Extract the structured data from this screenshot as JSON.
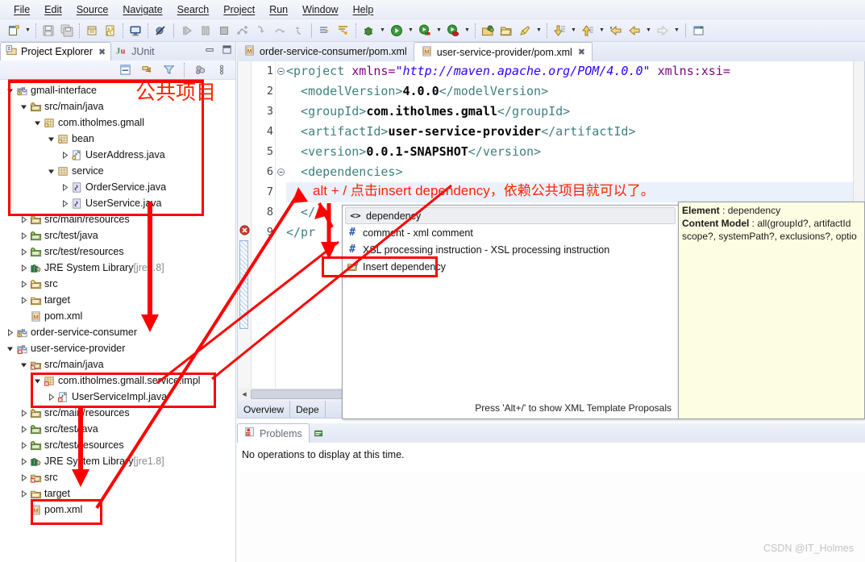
{
  "menubar": {
    "items": [
      {
        "label": "File"
      },
      {
        "label": "Edit"
      },
      {
        "label": "Source"
      },
      {
        "label": "Navigate"
      },
      {
        "label": "Search"
      },
      {
        "label": "Project"
      },
      {
        "label": "Run"
      },
      {
        "label": "Window"
      },
      {
        "label": "Help"
      }
    ]
  },
  "toolbar": {
    "icons": [
      {
        "name": "new-wizard-icon"
      },
      {
        "name": "new-dropdown-arrow-icon"
      },
      {
        "name": "save-icon"
      },
      {
        "name": "save-all-icon"
      },
      {
        "name": "print-icon"
      },
      {
        "name": "build-all-icon"
      },
      {
        "name": "open-console-icon"
      },
      {
        "name": "skip-breakpoints-icon"
      },
      {
        "name": "resume-icon"
      },
      {
        "name": "suspend-icon"
      },
      {
        "name": "terminate-icon"
      },
      {
        "name": "disconnect-icon"
      },
      {
        "name": "step-into-icon"
      },
      {
        "name": "step-over-icon"
      },
      {
        "name": "step-return-icon"
      },
      {
        "name": "next-annotation-icon"
      },
      {
        "name": "previous-annotation-icon"
      },
      {
        "name": "debug-icon"
      },
      {
        "name": "run-icon"
      },
      {
        "name": "run-last-tool-icon"
      },
      {
        "name": "coverage-icon"
      },
      {
        "name": "new-java-package-icon"
      },
      {
        "name": "new-folder-icon"
      },
      {
        "name": "search-icon"
      },
      {
        "name": "next-edit-icon"
      },
      {
        "name": "previous-edit-icon"
      },
      {
        "name": "back-history-icon"
      },
      {
        "name": "forward-history-icon"
      },
      {
        "name": "pin-editor-icon"
      }
    ]
  },
  "left_panel": {
    "tabs": [
      {
        "label": "Project Explorer",
        "icon": "project-explorer-icon",
        "active": true,
        "closeable": true
      },
      {
        "label": "JUnit",
        "icon": "junit-icon",
        "active": false,
        "closeable": false
      }
    ],
    "window_controls": [
      {
        "name": "minimize-icon"
      },
      {
        "name": "maximize-icon"
      }
    ],
    "view_toolbar": [
      {
        "name": "collapse-all-icon"
      },
      {
        "name": "link-with-editor-icon"
      },
      {
        "name": "filter-icon"
      },
      {
        "name": "working-sets-icon"
      },
      {
        "name": "view-menu-icon"
      }
    ],
    "tree": [
      {
        "label": "gmall-interface",
        "indent": 0,
        "icon": "maven-project-icon",
        "twisty": "expanded"
      },
      {
        "label": "src/main/java",
        "indent": 1,
        "icon": "source-folder-icon",
        "twisty": "expanded"
      },
      {
        "label": "com.itholmes.gmall",
        "indent": 2,
        "icon": "package-icon",
        "twisty": "expanded"
      },
      {
        "label": "bean",
        "indent": 3,
        "icon": "package-icon",
        "twisty": "expanded"
      },
      {
        "label": "UserAddress.java",
        "indent": 4,
        "icon": "java-class-icon",
        "twisty": "collapsed"
      },
      {
        "label": "service",
        "indent": 3,
        "icon": "package-plain-icon",
        "twisty": "expanded"
      },
      {
        "label": "OrderService.java",
        "indent": 4,
        "icon": "java-interface-icon",
        "twisty": "collapsed"
      },
      {
        "label": "UserService.java",
        "indent": 4,
        "icon": "java-interface-icon",
        "twisty": "collapsed"
      },
      {
        "label": "src/main/resources",
        "indent": 1,
        "icon": "source-folder-icon",
        "twisty": "collapsed"
      },
      {
        "label": "src/test/java",
        "indent": 1,
        "icon": "source-folder-green-icon",
        "twisty": "collapsed"
      },
      {
        "label": "src/test/resources",
        "indent": 1,
        "icon": "source-folder-green-icon",
        "twisty": "collapsed"
      },
      {
        "label": "JRE System Library",
        "suffix": " [jre1.8]",
        "indent": 1,
        "icon": "library-icon",
        "twisty": "collapsed"
      },
      {
        "label": "src",
        "indent": 1,
        "icon": "folder-icon",
        "twisty": "collapsed"
      },
      {
        "label": "target",
        "indent": 1,
        "icon": "plain-folder-icon",
        "twisty": "collapsed"
      },
      {
        "label": "pom.xml",
        "indent": 1,
        "icon": "maven-pom-icon",
        "twisty": "none"
      },
      {
        "label": "order-service-consumer",
        "indent": 0,
        "icon": "maven-project-icon",
        "twisty": "collapsed"
      },
      {
        "label": "user-service-provider",
        "indent": 0,
        "icon": "maven-project-error-icon",
        "twisty": "expanded"
      },
      {
        "label": "src/main/java",
        "indent": 1,
        "icon": "source-folder-error-icon",
        "twisty": "expanded"
      },
      {
        "label": "com.itholmes.gmall.service.impl",
        "indent": 2,
        "icon": "package-error-icon",
        "twisty": "expanded"
      },
      {
        "label": "UserServiceImpl.java",
        "indent": 3,
        "icon": "java-class-error-icon",
        "twisty": "collapsed"
      },
      {
        "label": "src/main/resources",
        "indent": 1,
        "icon": "source-folder-icon",
        "twisty": "collapsed"
      },
      {
        "label": "src/test/java",
        "indent": 1,
        "icon": "source-folder-green-icon",
        "twisty": "collapsed"
      },
      {
        "label": "src/test/resources",
        "indent": 1,
        "icon": "source-folder-green-icon",
        "twisty": "collapsed"
      },
      {
        "label": "JRE System Library",
        "suffix": " [jre1.8]",
        "indent": 1,
        "icon": "library-icon",
        "twisty": "collapsed"
      },
      {
        "label": "src",
        "indent": 1,
        "icon": "folder-error-icon",
        "twisty": "collapsed"
      },
      {
        "label": "target",
        "indent": 1,
        "icon": "plain-folder-icon",
        "twisty": "collapsed"
      },
      {
        "label": "pom.xml",
        "indent": 1,
        "icon": "maven-pom-icon",
        "twisty": "none"
      }
    ]
  },
  "editor": {
    "tabs": [
      {
        "label": "order-service-consumer/pom.xml",
        "active": false,
        "icon": "maven-pom-icon"
      },
      {
        "label": "user-service-provider/pom.xml",
        "active": true,
        "icon": "maven-pom-icon",
        "close": "✖"
      }
    ],
    "line_numbers": [
      "1",
      "2",
      "3",
      "4",
      "5",
      "6",
      "7",
      "8",
      "9"
    ],
    "lines": [
      {
        "n": 1,
        "segments": [
          {
            "t": "<project ",
            "c": "tagc"
          },
          {
            "t": "xmlns=",
            "c": "attrc"
          },
          {
            "t": "\"http://maven.apache.org/POM/4.0.0\"",
            "c": "strc"
          },
          {
            "t": " xmlns:xsi=",
            "c": "attrc"
          }
        ]
      },
      {
        "n": 2,
        "segments": [
          {
            "t": "  <modelVersion>",
            "c": "tagc"
          },
          {
            "t": "4.0.0",
            "c": "txtc"
          },
          {
            "t": "</modelVersion>",
            "c": "tagc"
          }
        ]
      },
      {
        "n": 3,
        "segments": [
          {
            "t": "  <groupId>",
            "c": "tagc"
          },
          {
            "t": "com.itholmes.gmall",
            "c": "txtc"
          },
          {
            "t": "</groupId>",
            "c": "tagc"
          }
        ]
      },
      {
        "n": 4,
        "segments": [
          {
            "t": "  <artifactId>",
            "c": "tagc"
          },
          {
            "t": "user-service-provider",
            "c": "txtc"
          },
          {
            "t": "</artifactId>",
            "c": "tagc"
          }
        ]
      },
      {
        "n": 5,
        "segments": [
          {
            "t": "  <version>",
            "c": "tagc"
          },
          {
            "t": "0.0.1-SNAPSHOT",
            "c": "txtc"
          },
          {
            "t": "</version>",
            "c": "tagc"
          }
        ]
      },
      {
        "n": 6,
        "segments": [
          {
            "t": "  <dependencies>",
            "c": "tagc"
          }
        ]
      },
      {
        "n": 7,
        "segments": [
          {
            "t": "    ",
            "c": "tagc"
          }
        ]
      },
      {
        "n": 8,
        "segments": [
          {
            "t": "  </",
            "c": "tagc"
          }
        ]
      },
      {
        "n": 9,
        "segments": [
          {
            "t": "</pr",
            "c": "tagc"
          }
        ]
      }
    ],
    "form_tabs": [
      {
        "label": "Overview"
      },
      {
        "label": "Depe"
      }
    ]
  },
  "content_assist": {
    "items": [
      {
        "label": "dependency",
        "icon": "xml-tag-icon",
        "selected": true
      },
      {
        "label": "comment - xml comment",
        "icon": "hash-icon",
        "selected": false
      },
      {
        "label": "XSL processing instruction - XSL processing instruction",
        "icon": "hash-icon",
        "selected": false
      },
      {
        "label": "Insert dependency",
        "icon": "template-icon",
        "selected": false
      }
    ],
    "hint": "Press 'Alt+/' to show XML Template Proposals",
    "doc": {
      "line1_label": "Element",
      "line1_value": " : dependency",
      "line2_label": "Content Model",
      "line2_value": " : all(groupId?, artifactId",
      "line3": "scope?, systemPath?, exclusions?, optio"
    }
  },
  "problems_view": {
    "tab_label": "Problems",
    "tab_icon": "problems-icon",
    "secondary_icon": "console-icon",
    "body_text": "No operations to display at this time."
  },
  "annotations": {
    "public_project_label": "公共项目",
    "editor_note": "alt + / 点击insert dependency，依赖公共项目就可以了。",
    "color": "#ff0000"
  },
  "watermark": "CSDN @IT_Holmes"
}
